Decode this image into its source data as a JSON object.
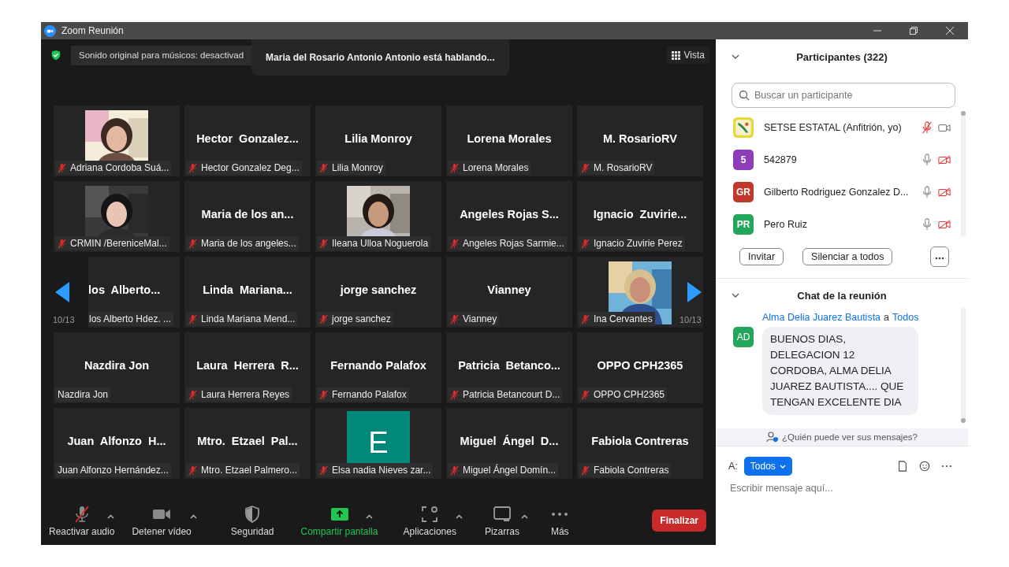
{
  "window": {
    "title": "Zoom Reunión"
  },
  "meeting": {
    "audio_notice": "Sonido original para músicos: desactivad",
    "speaking_banner": "Maria del Rosario Antonio Antonio está hablando...",
    "view_button": "Vista",
    "page_left": "10/13",
    "page_right": "10/13"
  },
  "tiles": [
    {
      "label": "Adriana Cordoba Suá...",
      "muted": true
    },
    {
      "kind": "name",
      "name": "Hector  Gonzalez...",
      "label": "Hector Gonzalez Deg...",
      "muted": true
    },
    {
      "kind": "name",
      "name": "Lilia Monroy",
      "label": "Lilia Monroy",
      "muted": true
    },
    {
      "kind": "name",
      "name": "Lorena Morales",
      "label": "Lorena Morales",
      "muted": true
    },
    {
      "kind": "name",
      "name": "M. RosarioRV",
      "label": "M. RosarioRV",
      "muted": true
    },
    {
      "label": "CRMIN /BereniceMal...",
      "muted": true
    },
    {
      "kind": "name",
      "name": "Maria de los an...",
      "label": "Maria de los angeles...",
      "muted": true
    },
    {
      "label": "Ileana Ulloa Noguerola",
      "muted": true
    },
    {
      "kind": "name",
      "name": "Angeles Rojas S...",
      "label": "Angeles Rojas Sarmie...",
      "muted": true
    },
    {
      "kind": "name",
      "name": "Ignacio  Zuvirie...",
      "label": "Ignacio Zuvirie Perez",
      "muted": true
    },
    {
      "kind": "partial",
      "name": "los  Alberto...",
      "label": "los Alberto Hdez. ...",
      "muted": false
    },
    {
      "kind": "name",
      "name": "Linda  Mariana...",
      "label": "Linda Mariana Mend...",
      "muted": true
    },
    {
      "kind": "name",
      "name": "jorge sanchez",
      "label": "jorge sanchez",
      "muted": true
    },
    {
      "kind": "name",
      "name": "Vianney",
      "label": "Vianney",
      "muted": true
    },
    {
      "label": "Ina Cervantes",
      "muted": true
    },
    {
      "kind": "name",
      "name": "Nazdira Jon",
      "label": "Nazdira Jon",
      "muted": false
    },
    {
      "kind": "name",
      "name": "Laura  Herrera  R...",
      "label": "Laura Herrera Reyes",
      "muted": true
    },
    {
      "kind": "name",
      "name": "Fernando Palafox",
      "label": "Fernando Palafox",
      "muted": true
    },
    {
      "kind": "name",
      "name": "Patricia  Betanco...",
      "label": "Patricia Betancourt D...",
      "muted": true
    },
    {
      "kind": "name",
      "name": "OPPO CPH2365",
      "label": "OPPO CPH2365",
      "muted": true
    },
    {
      "kind": "name",
      "name": "Juan  Alfonzo  H...",
      "label": "Juan Alfonzo Hernández...",
      "muted": false
    },
    {
      "kind": "name",
      "name": "Mtro.  Etzael  Pal...",
      "label": "Mtro. Etzael Palmero...",
      "muted": true
    },
    {
      "kind": "initial",
      "name": "E",
      "color": "#00897b",
      "label": "Elsa nadia Nieves zar...",
      "muted": true
    },
    {
      "kind": "name",
      "name": "Miguel  Ángel  D...",
      "label": "Miguel Ángel Domín...",
      "muted": true
    },
    {
      "kind": "name",
      "name": "Fabiola Contreras",
      "label": "Fabiola Contreras",
      "muted": true
    }
  ],
  "toolbar": [
    {
      "kind": "mic",
      "label": "Reactivar audio",
      "muted": true,
      "caret": true
    },
    {
      "kind": "video",
      "label": "Detener vídeo",
      "caret": true
    },
    {
      "kind": "security",
      "label": "Seguridad",
      "caret": false
    },
    {
      "kind": "share",
      "label": "Compartir pantalla",
      "caret": true
    },
    {
      "kind": "apps",
      "label": "Aplicaciones",
      "caret": true
    },
    {
      "kind": "whiteboard",
      "label": "Pizarras",
      "caret": true
    },
    {
      "kind": "more",
      "label": "Más",
      "caret": false
    }
  ],
  "end_button": "Finalizar",
  "participants": {
    "title": "Participantes (322)",
    "search": {
      "placeholder": "Buscar un participante"
    },
    "items": [
      {
        "kind": "logo",
        "name": "SETSE ESTATAL (Anfitrión, yo)",
        "mic_muted": true,
        "video_off": false
      },
      {
        "kind": "initials",
        "initials": "5",
        "color": "#8e3db8",
        "name": "542879",
        "mic_muted": false,
        "video_off": true
      },
      {
        "kind": "initials",
        "initials": "GR",
        "color": "#c0392b",
        "name": "Gilberto Rodriguez Gonzalez D...",
        "mic_muted": false,
        "video_off": true
      },
      {
        "kind": "initials",
        "initials": "PR",
        "color": "#23a55a",
        "name": "Pero Ruiz",
        "mic_muted": false,
        "video_off": true
      }
    ],
    "buttons": [
      "Invitar",
      "Silenciar a todos"
    ]
  },
  "chat": {
    "title": "Chat de la reunión",
    "messages": [
      {
        "sender": "Alma Delia Juarez Bautista",
        "to_word": "a",
        "recipient": "Todos",
        "initials": "AD",
        "color": "#23a55a",
        "text": "BUENOS DIAS, DELEGACION 12 CORDOBA, ALMA DELIA JUAREZ BAUTISTA.... QUE TENGAN EXCELENTE DIA"
      }
    ],
    "visibility_link": "¿Quién puede ver sus mensajes?",
    "to_label": "A:",
    "to_button": "Todos",
    "input": {
      "placeholder": "Escribir mensaje aquí..."
    }
  }
}
